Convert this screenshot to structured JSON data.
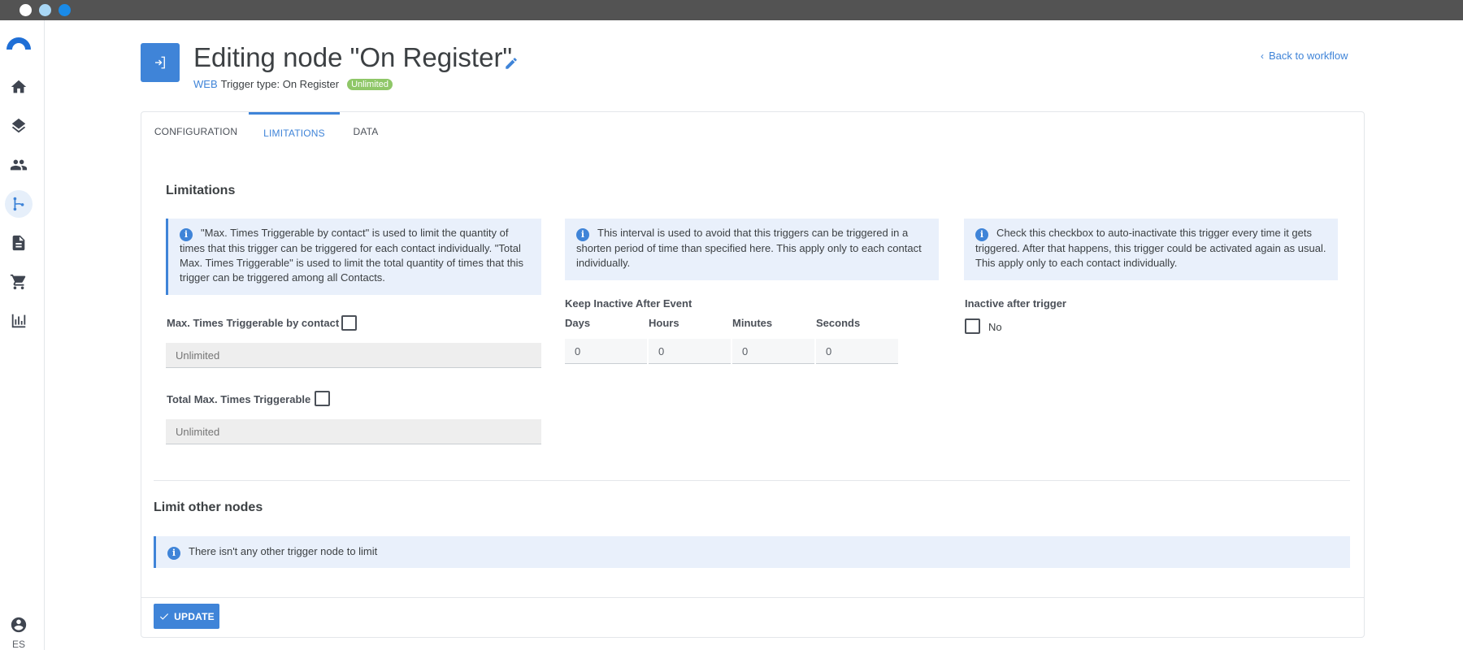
{
  "window": {
    "controls": [
      "close",
      "minimize",
      "maximize"
    ]
  },
  "sidebar": {
    "items": [
      {
        "icon": "home-icon"
      },
      {
        "icon": "layers-icon"
      },
      {
        "icon": "contacts-icon"
      },
      {
        "icon": "workflow-icon",
        "active": true
      },
      {
        "icon": "document-icon"
      },
      {
        "icon": "cart-icon"
      },
      {
        "icon": "chart-icon"
      }
    ],
    "language": "ES"
  },
  "header": {
    "title": "Editing node \"On Register\"",
    "channel": "WEB",
    "trigger_type": "Trigger type: On Register",
    "badge": "Unlimited",
    "back_link": "Back to workflow"
  },
  "tabs": [
    {
      "label": "CONFIGURATION",
      "active": false
    },
    {
      "label": "LIMITATIONS",
      "active": true
    },
    {
      "label": "DATA",
      "active": false
    }
  ],
  "limitations": {
    "title": "Limitations",
    "max_info": "\"Max. Times Triggerable by contact\" is used to limit the quantity of times that this trigger can be triggered for each contact individually. \"Total Max. Times Triggerable\" is used to limit the total quantity of times that this trigger can be triggered among all Contacts.",
    "interval_info": "This interval is used to avoid that this triggers can be triggered in a shorten period of time than specified here. This apply only to each contact individually.",
    "inactive_info": "Check this checkbox to auto-inactivate this trigger every time it gets triggered. After that happens, this trigger could be activated again as usual. This apply only to each contact individually.",
    "max_by_contact_label": "Max. Times Triggerable by contact",
    "max_by_contact_placeholder": "Unlimited",
    "total_max_label": "Total Max. Times Triggerable",
    "total_max_placeholder": "Unlimited",
    "keep_inactive_label": "Keep Inactive After Event",
    "units": [
      "Days",
      "Hours",
      "Minutes",
      "Seconds"
    ],
    "values": [
      "0",
      "0",
      "0",
      "0"
    ],
    "inactive_after_label": "Inactive after trigger",
    "inactive_after_value": "No"
  },
  "other_nodes": {
    "title": "Limit other nodes",
    "info": "There isn't any other trigger node to limit"
  },
  "footer": {
    "update_label": "UPDATE"
  },
  "colors": {
    "accent": "#3f84d8",
    "badge": "#8fc768",
    "info_bg": "#e9f0fb"
  }
}
